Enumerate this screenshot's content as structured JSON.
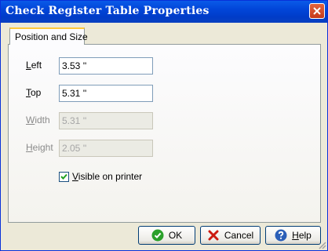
{
  "window": {
    "title": "Check Register Table Properties"
  },
  "tabs": [
    {
      "label": "Position and Size"
    }
  ],
  "fields": {
    "left": {
      "label_prefix": "",
      "label_accel": "L",
      "label_rest": "eft",
      "value": "3.53 ''"
    },
    "top": {
      "label_prefix": "",
      "label_accel": "T",
      "label_rest": "op",
      "value": "5.31 ''"
    },
    "width": {
      "label_prefix": "",
      "label_accel": "W",
      "label_rest": "idth",
      "value": "5.31 ''"
    },
    "height": {
      "label_prefix": "",
      "label_accel": "H",
      "label_rest": "eight",
      "value": "2.05 ''"
    }
  },
  "visible_on_printer": {
    "accel": "V",
    "rest": "isible on printer",
    "checked": true
  },
  "buttons": {
    "ok": {
      "accel": "",
      "rest": "OK",
      "icon": "check-circle-icon"
    },
    "cancel": {
      "accel": "",
      "rest": "Cancel",
      "icon": "x-cross-icon"
    },
    "help": {
      "accel": "H",
      "rest": "elp",
      "icon": "help-circle-icon"
    }
  },
  "colors": {
    "titlebar": "#0145d8",
    "close": "#c6391a",
    "ok_green": "#2aa02a",
    "cancel_red": "#cc1a10",
    "help_blue": "#2b5fb8"
  }
}
